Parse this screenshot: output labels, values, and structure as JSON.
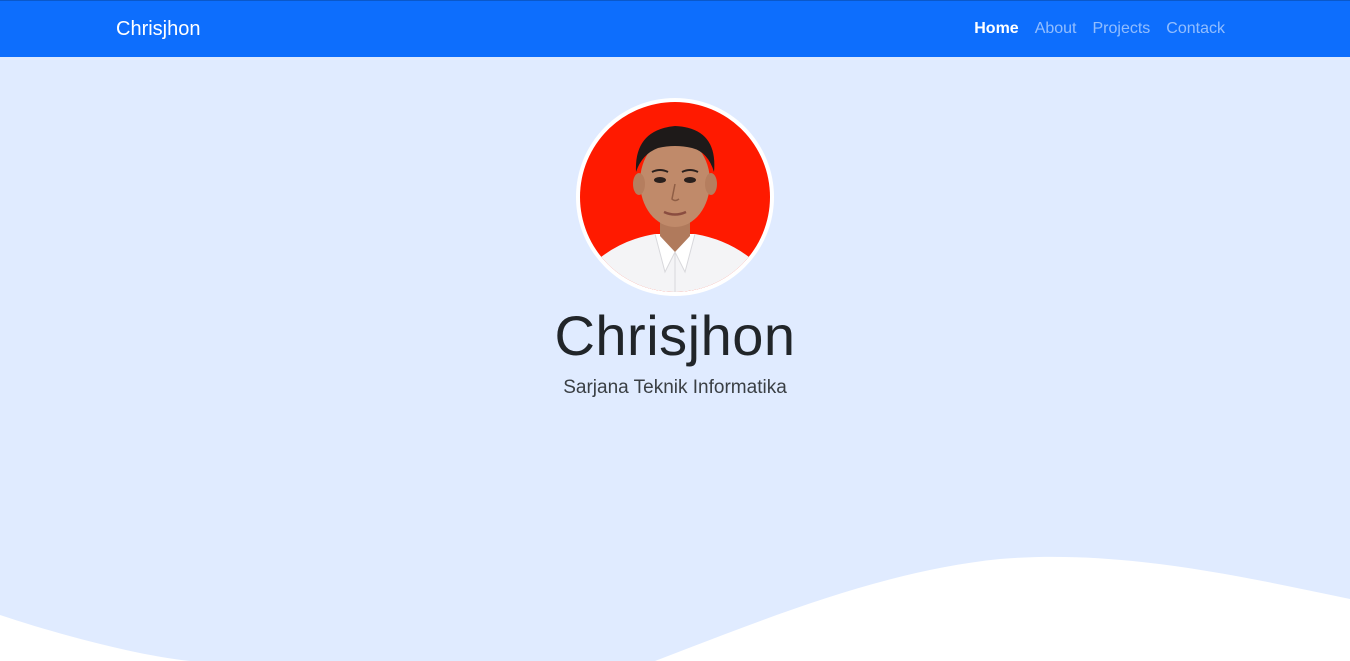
{
  "navbar": {
    "brand": "Chrisjhon",
    "links": [
      {
        "label": "Home",
        "active": true
      },
      {
        "label": "About",
        "active": false
      },
      {
        "label": "Projects",
        "active": false
      },
      {
        "label": "Contack",
        "active": false
      }
    ]
  },
  "hero": {
    "name": "Chrisjhon",
    "subtitle": "Sarjana Teknik Informatika",
    "photo_background": "#ff1a00"
  },
  "colors": {
    "navbar": "#0d6efd",
    "jumbotron": "#e0ebff",
    "wave": "#ffffff"
  }
}
